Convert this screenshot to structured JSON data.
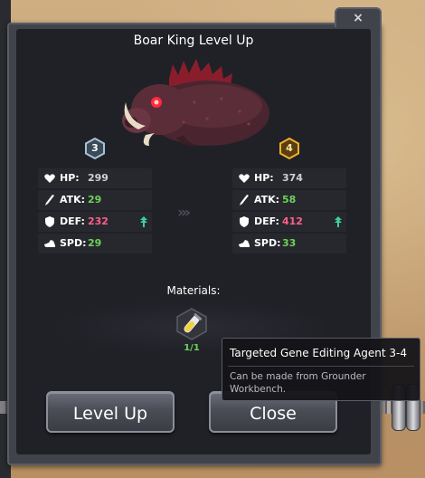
{
  "dialog": {
    "title": "Boar King Level Up",
    "close_glyph": "×",
    "creature_icon": "boar-king-portrait"
  },
  "current": {
    "level": "3",
    "badge_color": "#a7c3d6",
    "stats": [
      {
        "icon": "heart-icon",
        "label": "HP:",
        "value": "299",
        "color": "#d0d0d4",
        "arrow": false
      },
      {
        "icon": "sword-icon",
        "label": "ATK:",
        "value": "29",
        "color": "#6dd25a",
        "arrow": false
      },
      {
        "icon": "shield-icon",
        "label": "DEF:",
        "value": "232",
        "color": "#ff5f8a",
        "arrow": true
      },
      {
        "icon": "boot-icon",
        "label": "SPD:",
        "value": "29",
        "color": "#6dd25a",
        "arrow": false
      }
    ]
  },
  "next": {
    "level": "4",
    "badge_color": "#f0b12a",
    "stats": [
      {
        "icon": "heart-icon",
        "label": "HP:",
        "value": "374",
        "color": "#d0d0d4",
        "arrow": false
      },
      {
        "icon": "sword-icon",
        "label": "ATK:",
        "value": "58",
        "color": "#6dd25a",
        "arrow": false
      },
      {
        "icon": "shield-icon",
        "label": "DEF:",
        "value": "412",
        "color": "#ff5f8a",
        "arrow": true
      },
      {
        "icon": "boot-icon",
        "label": "SPD:",
        "value": "33",
        "color": "#6dd25a",
        "arrow": false
      }
    ]
  },
  "separator_glyph": "›››",
  "materials": {
    "label": "Materials:",
    "items": [
      {
        "icon": "gene-editing-vial-icon",
        "count": "1/1"
      }
    ]
  },
  "buttons": {
    "level_up": "Level Up",
    "close": "Close"
  },
  "tooltip": {
    "title": "Targeted Gene Editing Agent 3-4",
    "description": "Can be made from Grounder Workbench."
  },
  "colors": {
    "stat_up_arrow": "#3ccf9a",
    "panel_bg": "#202127"
  }
}
